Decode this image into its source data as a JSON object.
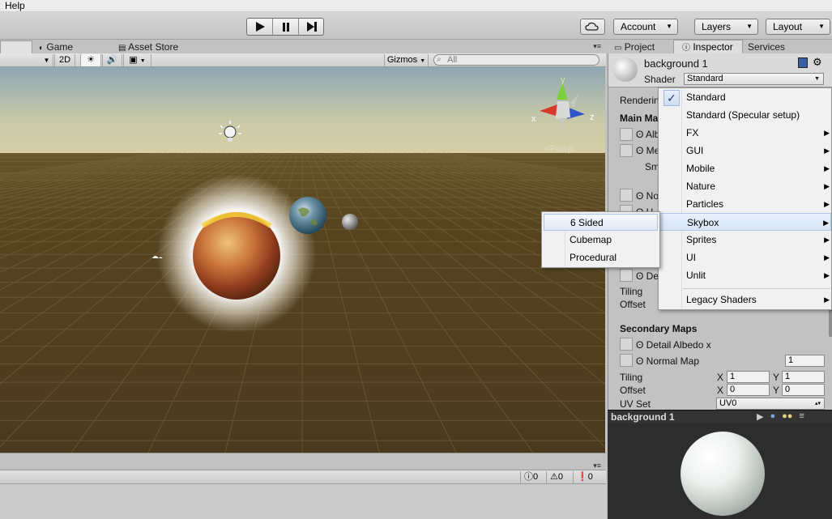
{
  "menubar": {
    "help": "Help"
  },
  "toolbar": {
    "cloud_icon": "cloud-icon",
    "account": "Account",
    "layers": "Layers",
    "layout": "Layout"
  },
  "scene": {
    "tabs": {
      "game": "Game",
      "asset_store": "Asset Store"
    },
    "bar": {
      "mode_2d": "2D",
      "gizmos": "Gizmos",
      "search_placeholder": "All"
    },
    "gizmo": {
      "persp": "Persp",
      "x": "x",
      "y": "y",
      "z": "z"
    }
  },
  "console": {
    "errors": "0",
    "warnings": "0",
    "messages": "0"
  },
  "inspector": {
    "tabs": {
      "project": "Project",
      "inspector": "Inspector",
      "services": "Services"
    },
    "object_name": "background 1",
    "shader_label": "Shader",
    "shader_value": "Standard",
    "rendering_label": "Renderin",
    "main_maps": "Main Ma",
    "albedo": "Alb",
    "metallic": "Met",
    "smoothness": "Sm",
    "s_short": "S",
    "normal": "Nor",
    "height": "H",
    "detail": "Det",
    "tiling": "Tiling",
    "offset": "Offset",
    "secondary_maps": "Secondary Maps",
    "detail_albedo": "Detail Albedo x",
    "normal_map": "Normal Map",
    "normal_map_value": "1",
    "sec_tiling_label": "Tiling",
    "sec_offset_label": "Offset",
    "x": "X",
    "y": "Y",
    "tiling_x": "1",
    "tiling_y": "1",
    "offset_x": "0",
    "offset_y": "0",
    "uv_set_label": "UV Set",
    "uv_set_value": "UV0"
  },
  "preview": {
    "title": "background 1"
  },
  "dropdown": {
    "items": [
      "Standard",
      "Standard (Specular setup)",
      "FX",
      "GUI",
      "Mobile",
      "Nature",
      "Particles",
      "Skybox",
      "Sprites",
      "UI",
      "Unlit",
      "Legacy Shaders"
    ],
    "checked": "Standard",
    "highlighted": "Skybox"
  },
  "submenu": {
    "items": [
      "6 Sided",
      "Cubemap",
      "Procedural"
    ],
    "highlighted": "6 Sided"
  },
  "colors": {
    "scene_ground": "#4b3b1e",
    "sky_top": "#8fa7b3",
    "menu_highlight": "#d6e5f7"
  }
}
